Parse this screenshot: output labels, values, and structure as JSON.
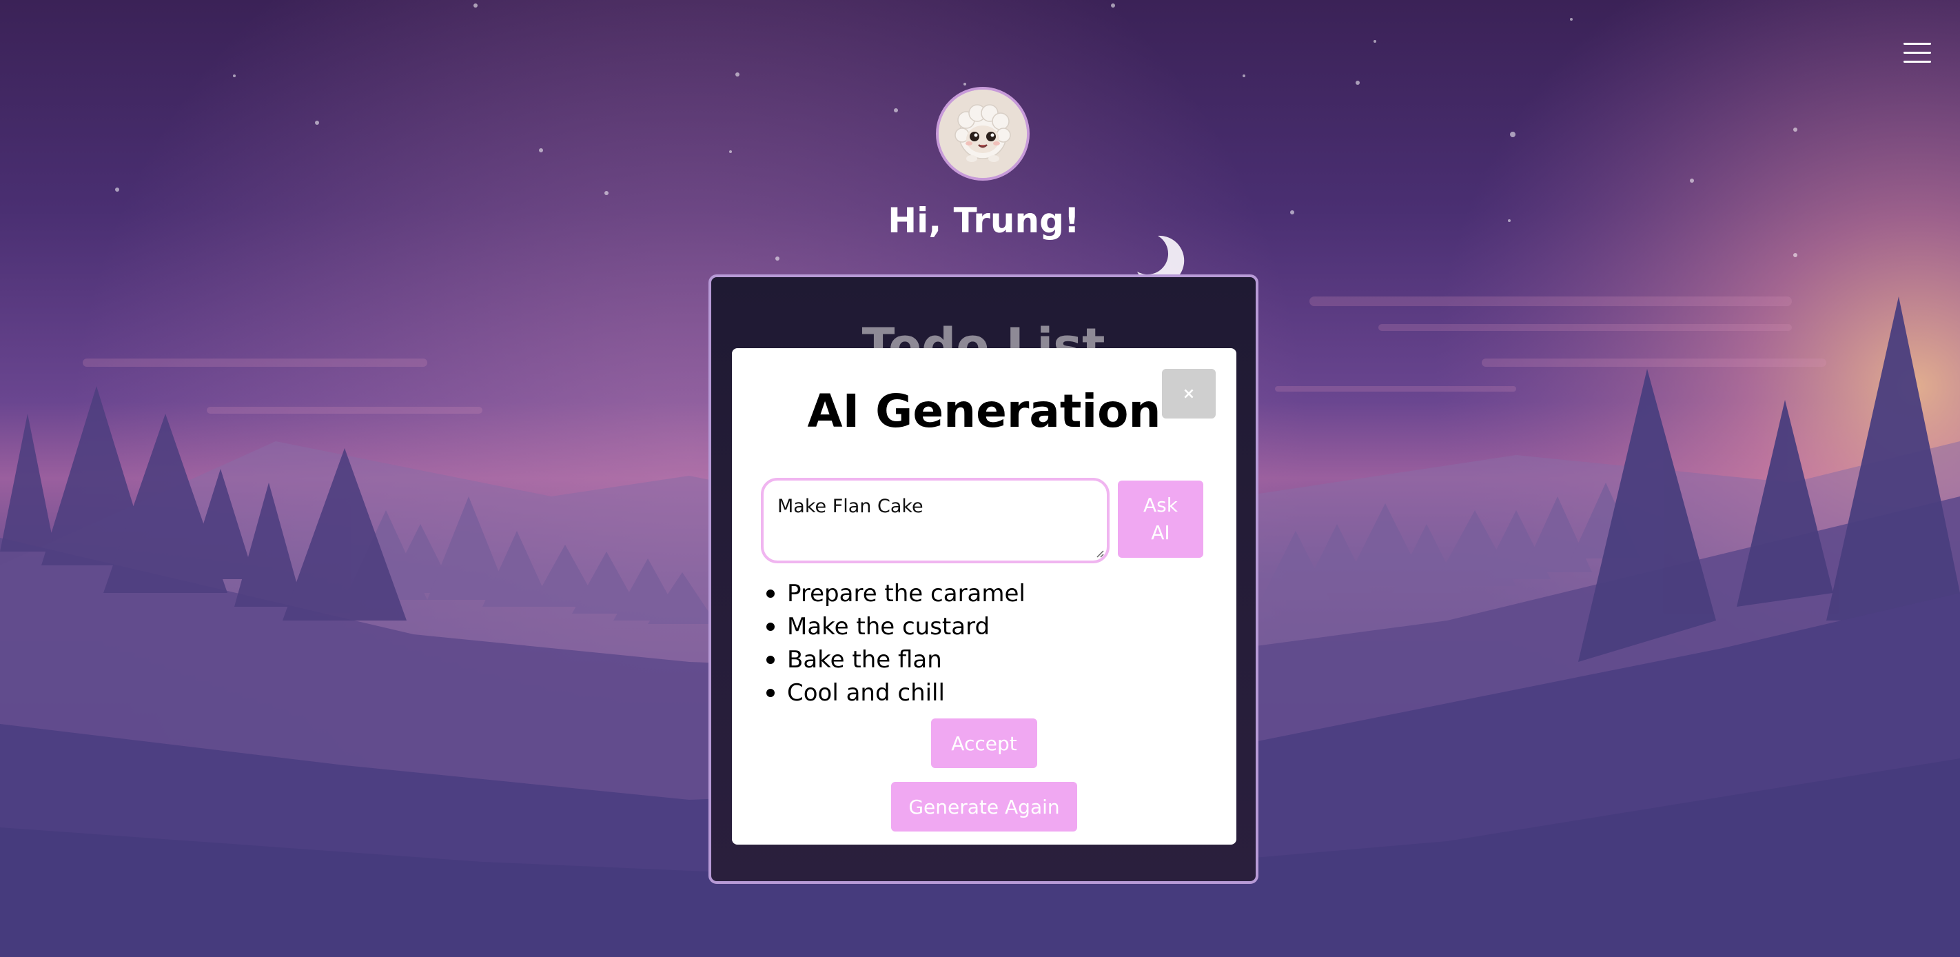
{
  "app": {
    "greeting": "Hi, Trung!"
  },
  "nav": {
    "menu_icon": "hamburger-menu-icon"
  },
  "avatar": {
    "icon": "fluffy-creature-avatar"
  },
  "background": {
    "icon": "crescent-moon-icon"
  },
  "todo": {
    "title": "Todo List"
  },
  "modal": {
    "title": "AI Generation",
    "close_label": "×",
    "prompt_value": "Make Flan Cake",
    "ask_label": "Ask\nAI",
    "results": [
      "Prepare the caramel",
      "Make the custard",
      "Bake the flan",
      "Cool and chill"
    ],
    "accept_label": "Accept",
    "regenerate_label": "Generate Again"
  },
  "colors": {
    "accent": "#f0a8f2",
    "input_border": "#f0b5f0",
    "card_border": "#b79ad6",
    "close_button": "#cfcfcf"
  }
}
